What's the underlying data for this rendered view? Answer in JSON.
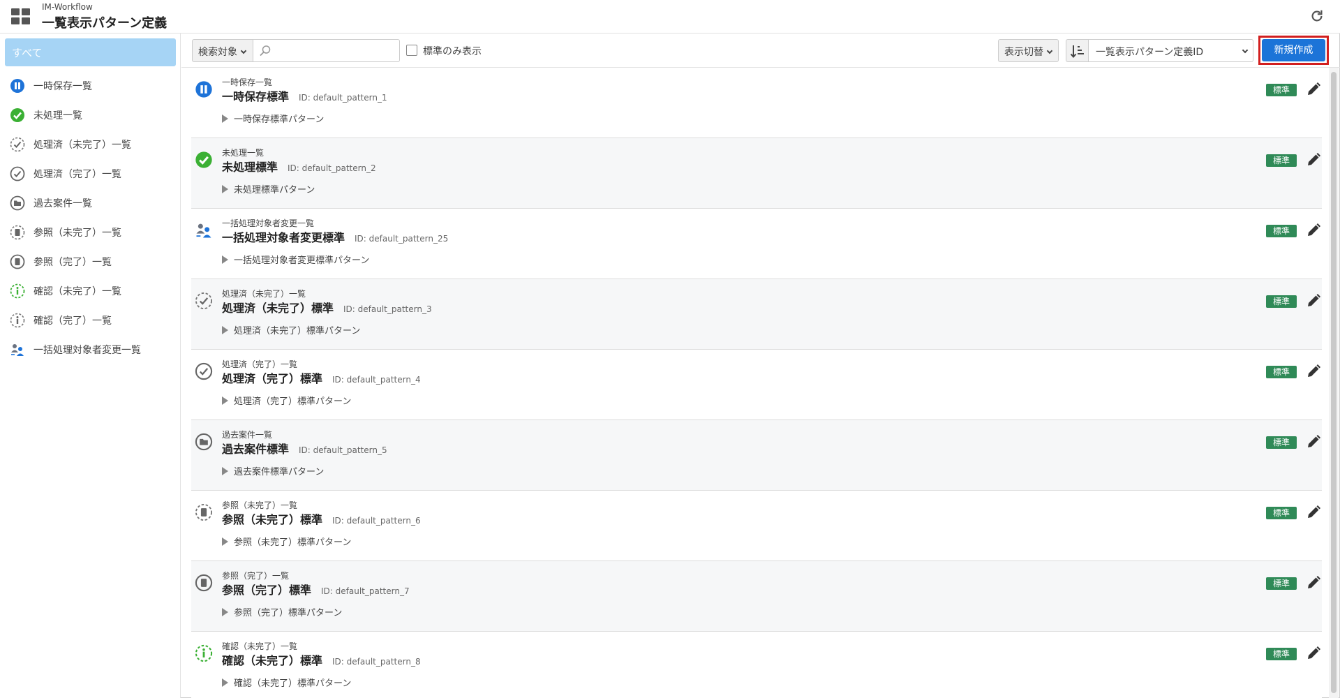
{
  "header": {
    "app_name": "IM-Workflow",
    "page_title": "一覧表示パターン定義"
  },
  "sidebar": {
    "all_label": "すべて",
    "items": [
      {
        "label": "一時保存一覧",
        "icon": "pause-icon"
      },
      {
        "label": "未処理一覧",
        "icon": "check-circle-icon"
      },
      {
        "label": "処理済（未完了）一覧",
        "icon": "dashed-check-icon"
      },
      {
        "label": "処理済（完了）一覧",
        "icon": "check-outline-icon"
      },
      {
        "label": "過去案件一覧",
        "icon": "folder-icon"
      },
      {
        "label": "参照（未完了）一覧",
        "icon": "dashed-document-icon"
      },
      {
        "label": "参照（完了）一覧",
        "icon": "document-icon"
      },
      {
        "label": "確認（未完了）一覧",
        "icon": "dashed-info-icon"
      },
      {
        "label": "確認（完了）一覧",
        "icon": "info-icon"
      },
      {
        "label": "一括処理対象者変更一覧",
        "icon": "user-change-icon"
      }
    ]
  },
  "toolbar": {
    "search_target_label": "検索対象",
    "search_placeholder": "",
    "standard_only_label": "標準のみ表示",
    "view_switch_label": "表示切替",
    "sort_field": "一覧表示パターン定義ID",
    "new_button_label": "新規作成"
  },
  "rows": [
    {
      "category": "一時保存一覧",
      "title": "一時保存標準",
      "id_text": "ID: default_pattern_1",
      "description": "一時保存標準パターン",
      "badge": "標準",
      "icon": "pause-icon"
    },
    {
      "category": "未処理一覧",
      "title": "未処理標準",
      "id_text": "ID: default_pattern_2",
      "description": "未処理標準パターン",
      "badge": "標準",
      "icon": "check-circle-icon"
    },
    {
      "category": "一括処理対象者変更一覧",
      "title": "一括処理対象者変更標準",
      "id_text": "ID: default_pattern_25",
      "description": "一括処理対象者変更標準パターン",
      "badge": "標準",
      "icon": "user-change-icon"
    },
    {
      "category": "処理済（未完了）一覧",
      "title": "処理済（未完了）標準",
      "id_text": "ID: default_pattern_3",
      "description": "処理済（未完了）標準パターン",
      "badge": "標準",
      "icon": "dashed-check-icon"
    },
    {
      "category": "処理済（完了）一覧",
      "title": "処理済（完了）標準",
      "id_text": "ID: default_pattern_4",
      "description": "処理済（完了）標準パターン",
      "badge": "標準",
      "icon": "check-outline-icon"
    },
    {
      "category": "過去案件一覧",
      "title": "過去案件標準",
      "id_text": "ID: default_pattern_5",
      "description": "過去案件標準パターン",
      "badge": "標準",
      "icon": "folder-icon"
    },
    {
      "category": "参照（未完了）一覧",
      "title": "参照（未完了）標準",
      "id_text": "ID: default_pattern_6",
      "description": "参照（未完了）標準パターン",
      "badge": "標準",
      "icon": "dashed-document-icon"
    },
    {
      "category": "参照（完了）一覧",
      "title": "参照（完了）標準",
      "id_text": "ID: default_pattern_7",
      "description": "参照（完了）標準パターン",
      "badge": "標準",
      "icon": "document-icon"
    },
    {
      "category": "確認（未完了）一覧",
      "title": "確認（未完了）標準",
      "id_text": "ID: default_pattern_8",
      "description": "確認（未完了）標準パターン",
      "badge": "標準",
      "icon": "dashed-info-icon"
    }
  ],
  "colors": {
    "primary": "#1c74d8",
    "badge": "#2f8a57",
    "selected": "#a6d4f5",
    "highlight": "#d21f1f"
  }
}
